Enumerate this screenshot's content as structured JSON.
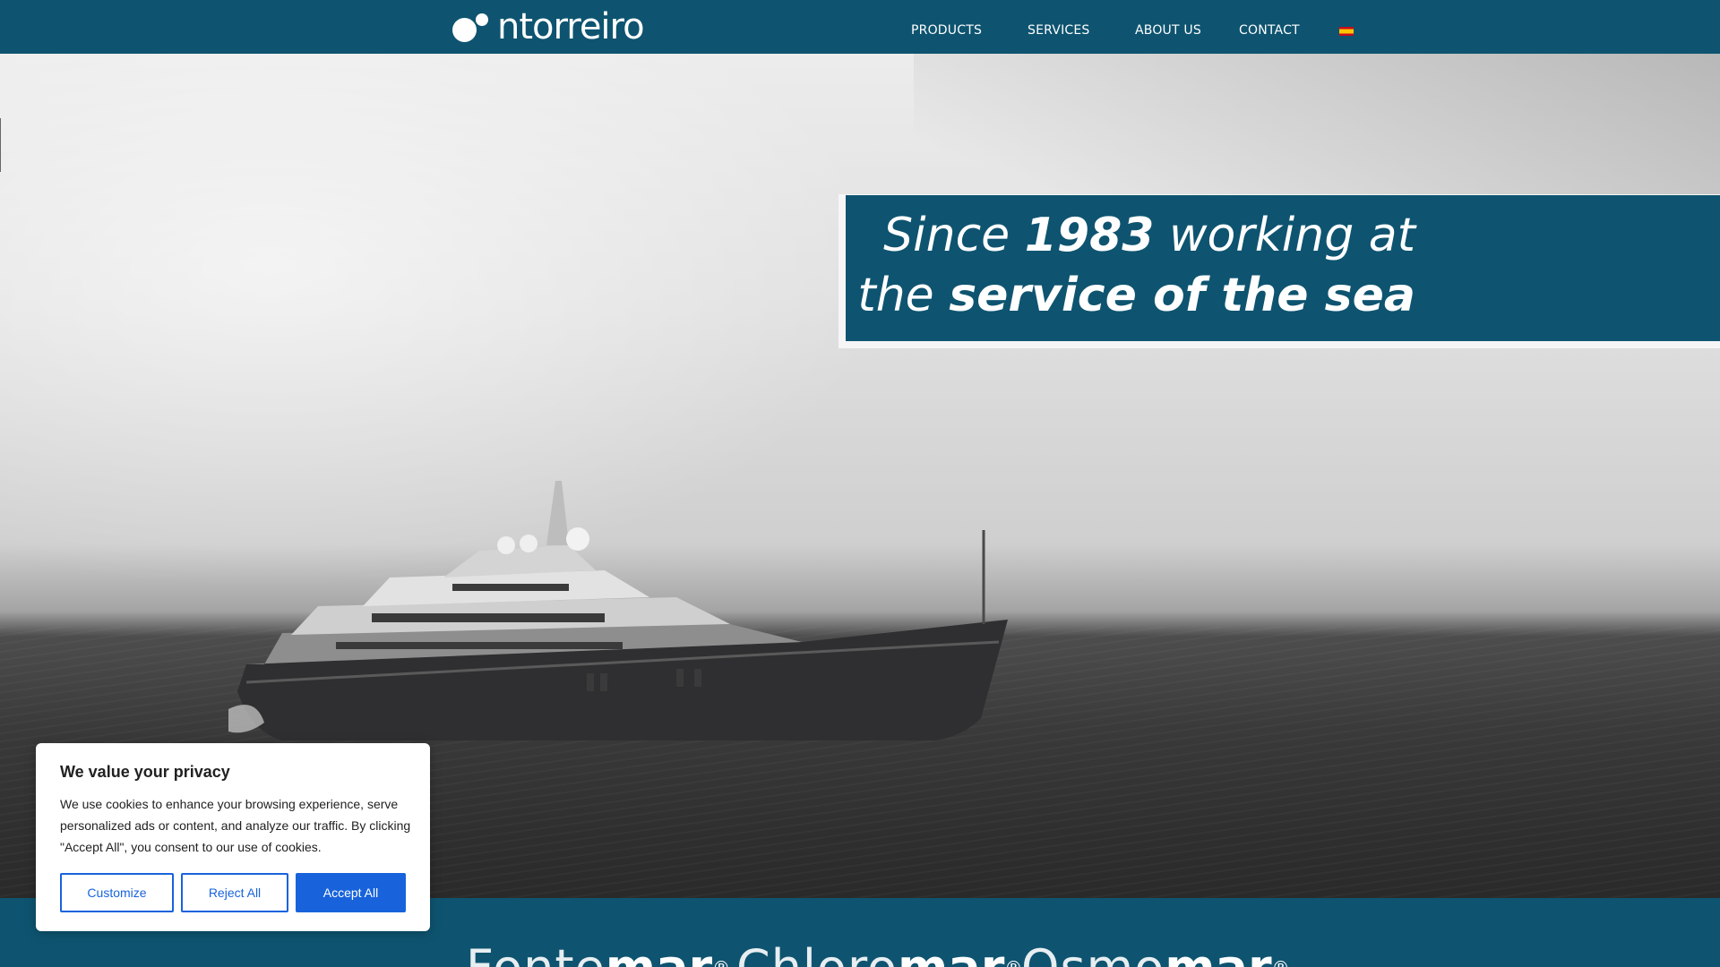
{
  "header": {
    "logo_text": "ntorreiro",
    "nav": [
      "PRODUCTS",
      "SERVICES",
      "ABOUT US",
      "CONTACT"
    ],
    "language_flag": "spain-flag-icon"
  },
  "hero": {
    "tagline_line1_a": "Since ",
    "tagline_line1_b": "1983",
    "tagline_line1_c": " working at",
    "tagline_line2_a": "the ",
    "tagline_line2_b": "service of the sea"
  },
  "brands": [
    {
      "thin": "Fonte",
      "bold": "mar",
      "mark": "®"
    },
    {
      "thin": "Chloro",
      "bold": "mar",
      "mark": "®"
    },
    {
      "thin": "Osmo",
      "bold": "mar",
      "mark": "®"
    }
  ],
  "cookie": {
    "title": "We value your privacy",
    "body": "We use cookies to enhance your browsing experience, serve personalized ads or content, and analyze our traffic. By clicking \"Accept All\", you consent to our use of cookies.",
    "customize": "Customize",
    "reject": "Reject All",
    "accept": "Accept All"
  },
  "colors": {
    "brand": "#0e5470",
    "button": "#1863dc"
  }
}
